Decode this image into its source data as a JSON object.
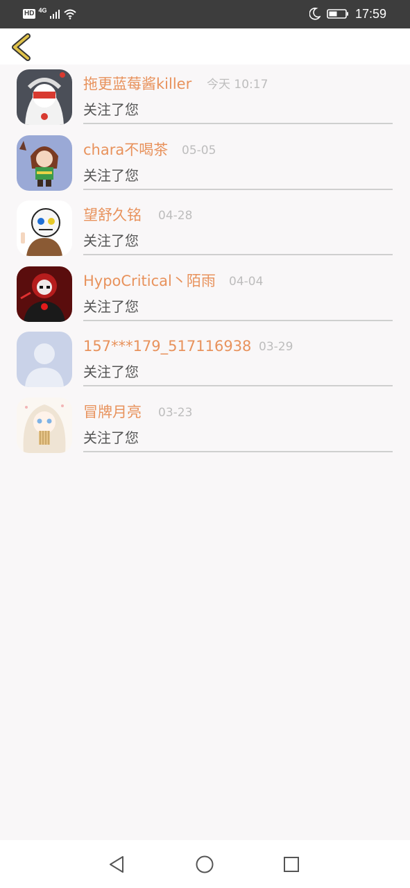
{
  "status_bar": {
    "hd": "HD",
    "network": "4G",
    "time": "17:59",
    "icons": [
      "signal-icon",
      "wifi-icon",
      "moon-icon",
      "battery-icon"
    ]
  },
  "header": {
    "back_icon": "back-chevron-icon",
    "accent_color": "#e0c24a"
  },
  "colors": {
    "name": "#e8925c",
    "time": "#bdbdbd",
    "action": "#555555",
    "background": "#f9f7f8"
  },
  "notifications": [
    {
      "name": "拖更蓝莓酱killer",
      "time": "今天 10:17",
      "action": "关注了您"
    },
    {
      "name": "chara不喝茶",
      "time": "05-05",
      "action": "关注了您"
    },
    {
      "name": "望舒久铭",
      "time": "04-28",
      "action": "关注了您"
    },
    {
      "name": "HypoCritical丶陌雨",
      "time": "04-04",
      "action": "关注了您"
    },
    {
      "name": "157***179_517116938",
      "time": "03-29",
      "action": "关注了您"
    },
    {
      "name": "冒牌月亮",
      "time": "03-23",
      "action": "关注了您"
    }
  ],
  "nav_bar": {
    "icons": [
      "back-triangle-icon",
      "home-circle-icon",
      "recents-square-icon"
    ]
  }
}
